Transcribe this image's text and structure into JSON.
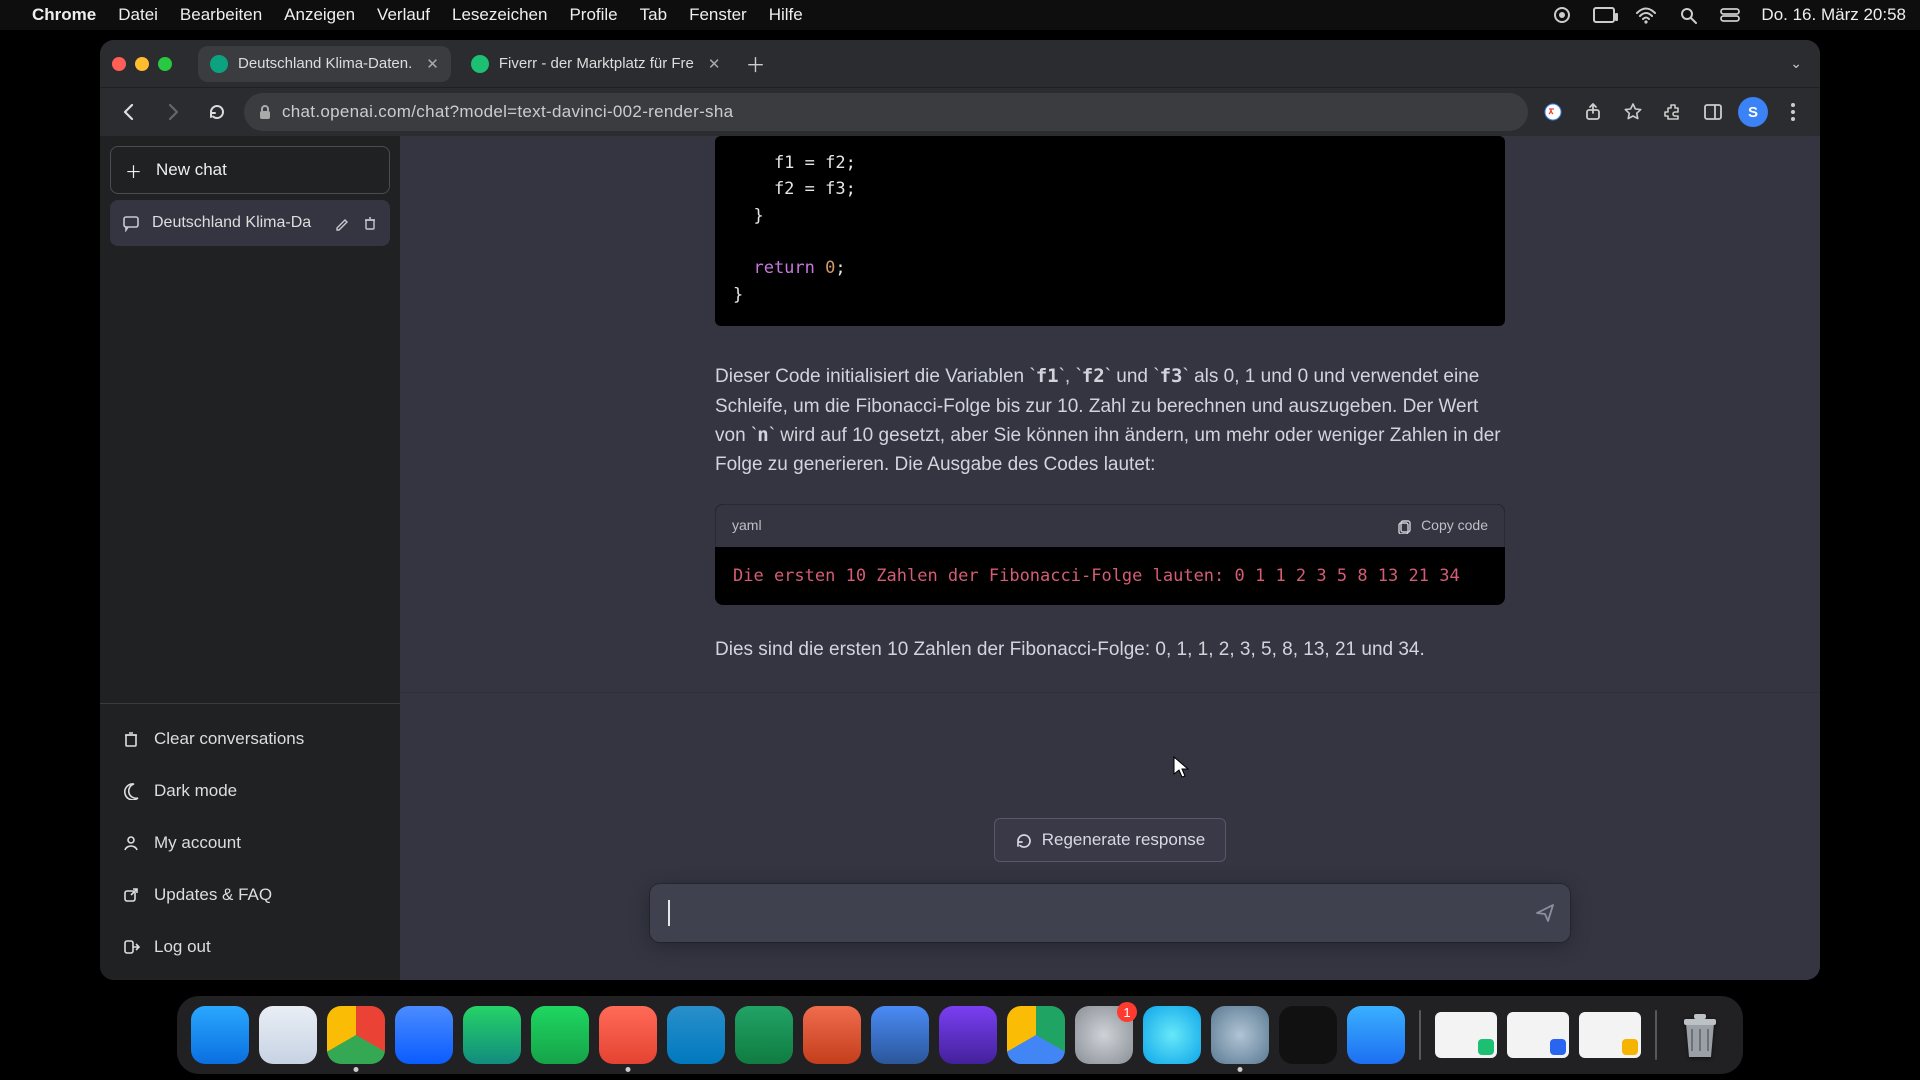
{
  "menubar": {
    "app": "Chrome",
    "items": [
      "Datei",
      "Bearbeiten",
      "Anzeigen",
      "Verlauf",
      "Lesezeichen",
      "Profile",
      "Tab",
      "Fenster",
      "Hilfe"
    ],
    "clock": "Do. 16. März  20:58"
  },
  "tabs": {
    "active": {
      "title": "Deutschland Klima-Daten."
    },
    "other": {
      "title": "Fiverr - der Marktplatz für Fre"
    }
  },
  "omnibox": {
    "url": "chat.openai.com/chat?model=text-davinci-002-render-sha"
  },
  "profile_initial": "S",
  "sidebar": {
    "new_chat": "New chat",
    "active_conv": "Deutschland Klima-Da",
    "footer": {
      "clear": "Clear conversations",
      "dark": "Dark mode",
      "account": "My account",
      "updates": "Updates & FAQ",
      "logout": "Log out"
    }
  },
  "assistant": {
    "code_lines": {
      "l1": "    f1 = f2;",
      "l2": "    f2 = f3;",
      "l3": "  }",
      "l4": "",
      "ret_kw": "  return ",
      "ret_num": "0",
      "ret_tail": ";",
      "l6": "}"
    },
    "para1_a": "Dieser Code initialisiert die Variablen ",
    "v_f1": "f1",
    "v_f2": "f2",
    "v_f3": "f3",
    "para1_b": ", ",
    "para1_c": " und ",
    "para1_d": " als 0, 1 und 0 und verwendet eine Schleife, um die Fibonacci-Folge bis zur 10. Zahl zu berechnen und auszugeben. Der Wert von ",
    "v_n": "n",
    "para1_e": " wird auf 10 gesetzt, aber Sie können ihn ändern, um mehr oder weniger Zahlen in der Folge zu generieren. Die Ausgabe des Codes lautet:",
    "output_lang": "yaml",
    "copy_label": "Copy code",
    "output_text": "Die ersten 10 Zahlen der Fibonacci-Folge lauten: 0 1 1 2 3 5 8 13 21 34",
    "summary": "Dies sind die ersten 10 Zahlen der Fibonacci-Folge: 0, 1, 1, 2, 3, 5, 8, 13, 21 und 34."
  },
  "bottom": {
    "regenerate": "Regenerate response"
  },
  "dock": {
    "icons": [
      {
        "name": "finder",
        "bg": "linear-gradient(#2aa7ff,#0a6fe0)"
      },
      {
        "name": "safari",
        "bg": "linear-gradient(#e9eef5,#c7d3e3)"
      },
      {
        "name": "chrome",
        "bg": "conic-gradient(#ea4335 0 120deg,#34a853 120deg 240deg,#fbbc05 240deg 360deg)",
        "running": true
      },
      {
        "name": "zoom",
        "bg": "linear-gradient(#4a8cff,#0b5cff)"
      },
      {
        "name": "whatsapp",
        "bg": "linear-gradient(#25d366,#128c7e)"
      },
      {
        "name": "spotify",
        "bg": "linear-gradient(#1ed760,#16a34a)"
      },
      {
        "name": "todoist",
        "bg": "linear-gradient(#ff6b57,#e44332)",
        "running": true
      },
      {
        "name": "trello",
        "bg": "linear-gradient(#298fca,#0079bf)"
      },
      {
        "name": "excel",
        "bg": "linear-gradient(#21a366,#107c41)"
      },
      {
        "name": "powerpoint",
        "bg": "linear-gradient(#ef6c4d,#c43e1c)"
      },
      {
        "name": "word",
        "bg": "linear-gradient(#4a8bf5,#2b579a)"
      },
      {
        "name": "imovie",
        "bg": "linear-gradient(#7a3ff2,#43219b)"
      },
      {
        "name": "drive",
        "bg": "conic-gradient(#1fa463 0 120deg,#4285f4 120deg 240deg,#fbbc05 240deg 360deg)"
      },
      {
        "name": "settings",
        "bg": "radial-gradient(circle at 50% 50%, #cfd3d8, #8a8f96)",
        "badge": true
      },
      {
        "name": "siri",
        "bg": "radial-gradient(circle at 50% 50%, #67e8f9, #0ea5e9)"
      },
      {
        "name": "quicktime",
        "bg": "radial-gradient(circle at 50% 50%, #b0c4d4, #5b7a93)",
        "running": true
      },
      {
        "name": "voice-memos",
        "bg": "#111"
      },
      {
        "name": "appstore",
        "bg": "linear-gradient(#3ab0ff,#1d6ff2)"
      }
    ]
  }
}
